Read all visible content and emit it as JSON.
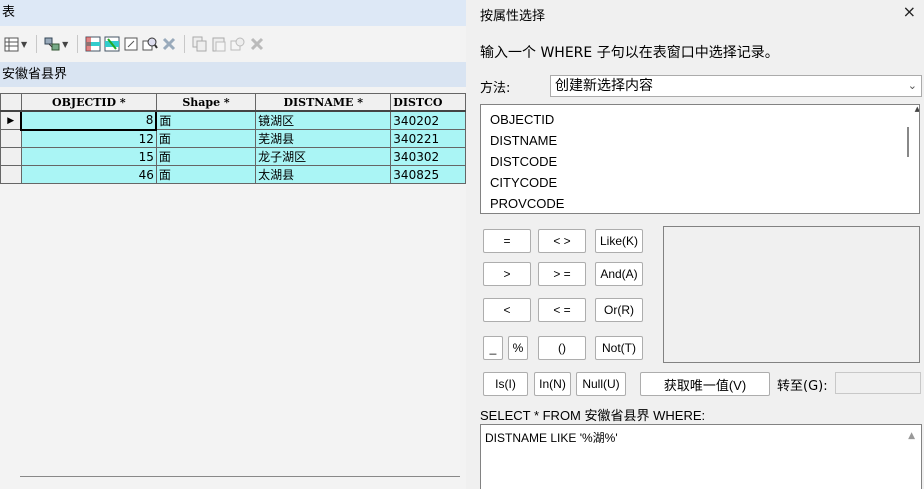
{
  "table_window": {
    "title": "表",
    "layer_tab": "安徽省县界",
    "columns": [
      "OBJECTID *",
      "Shape *",
      "DISTNAME *",
      "DISTCO"
    ],
    "rows": [
      {
        "objectid": "8",
        "shape": "面",
        "distname": "镜湖区",
        "distcode": "340202"
      },
      {
        "objectid": "12",
        "shape": "面",
        "distname": "芜湖县",
        "distcode": "340221"
      },
      {
        "objectid": "15",
        "shape": "面",
        "distname": "龙子湖区",
        "distcode": "340302"
      },
      {
        "objectid": "46",
        "shape": "面",
        "distname": "太湖县",
        "distcode": "340825"
      }
    ]
  },
  "dialog": {
    "title": "按属性选择",
    "close": "×",
    "description": "输入一个 WHERE 子句以在表窗口中选择记录。",
    "method_label": "方法:",
    "method_value": "创建新选择内容",
    "fields": [
      "OBJECTID",
      "DISTNAME",
      "DISTCODE",
      "CITYCODE",
      "PROVCODE"
    ],
    "operators": {
      "eq": "=",
      "ne": "< >",
      "like": "Like(K)",
      "gt": ">",
      "ge": "> =",
      "and": "And(A)",
      "lt": "<",
      "le": "< =",
      "or": "Or(R)",
      "underscore": "_",
      "percent": "%",
      "parens": "()",
      "not": "Not(T)",
      "is": "Is(I)",
      "in": "In(N)",
      "null": "Null(U)"
    },
    "unique_values_button": "获取唯一值(V)",
    "goto_label": "转至(G):",
    "select_prefix": "SELECT * FROM 安徽省县界 WHERE:",
    "where_clause": "DISTNAME LIKE '%湖%'"
  }
}
